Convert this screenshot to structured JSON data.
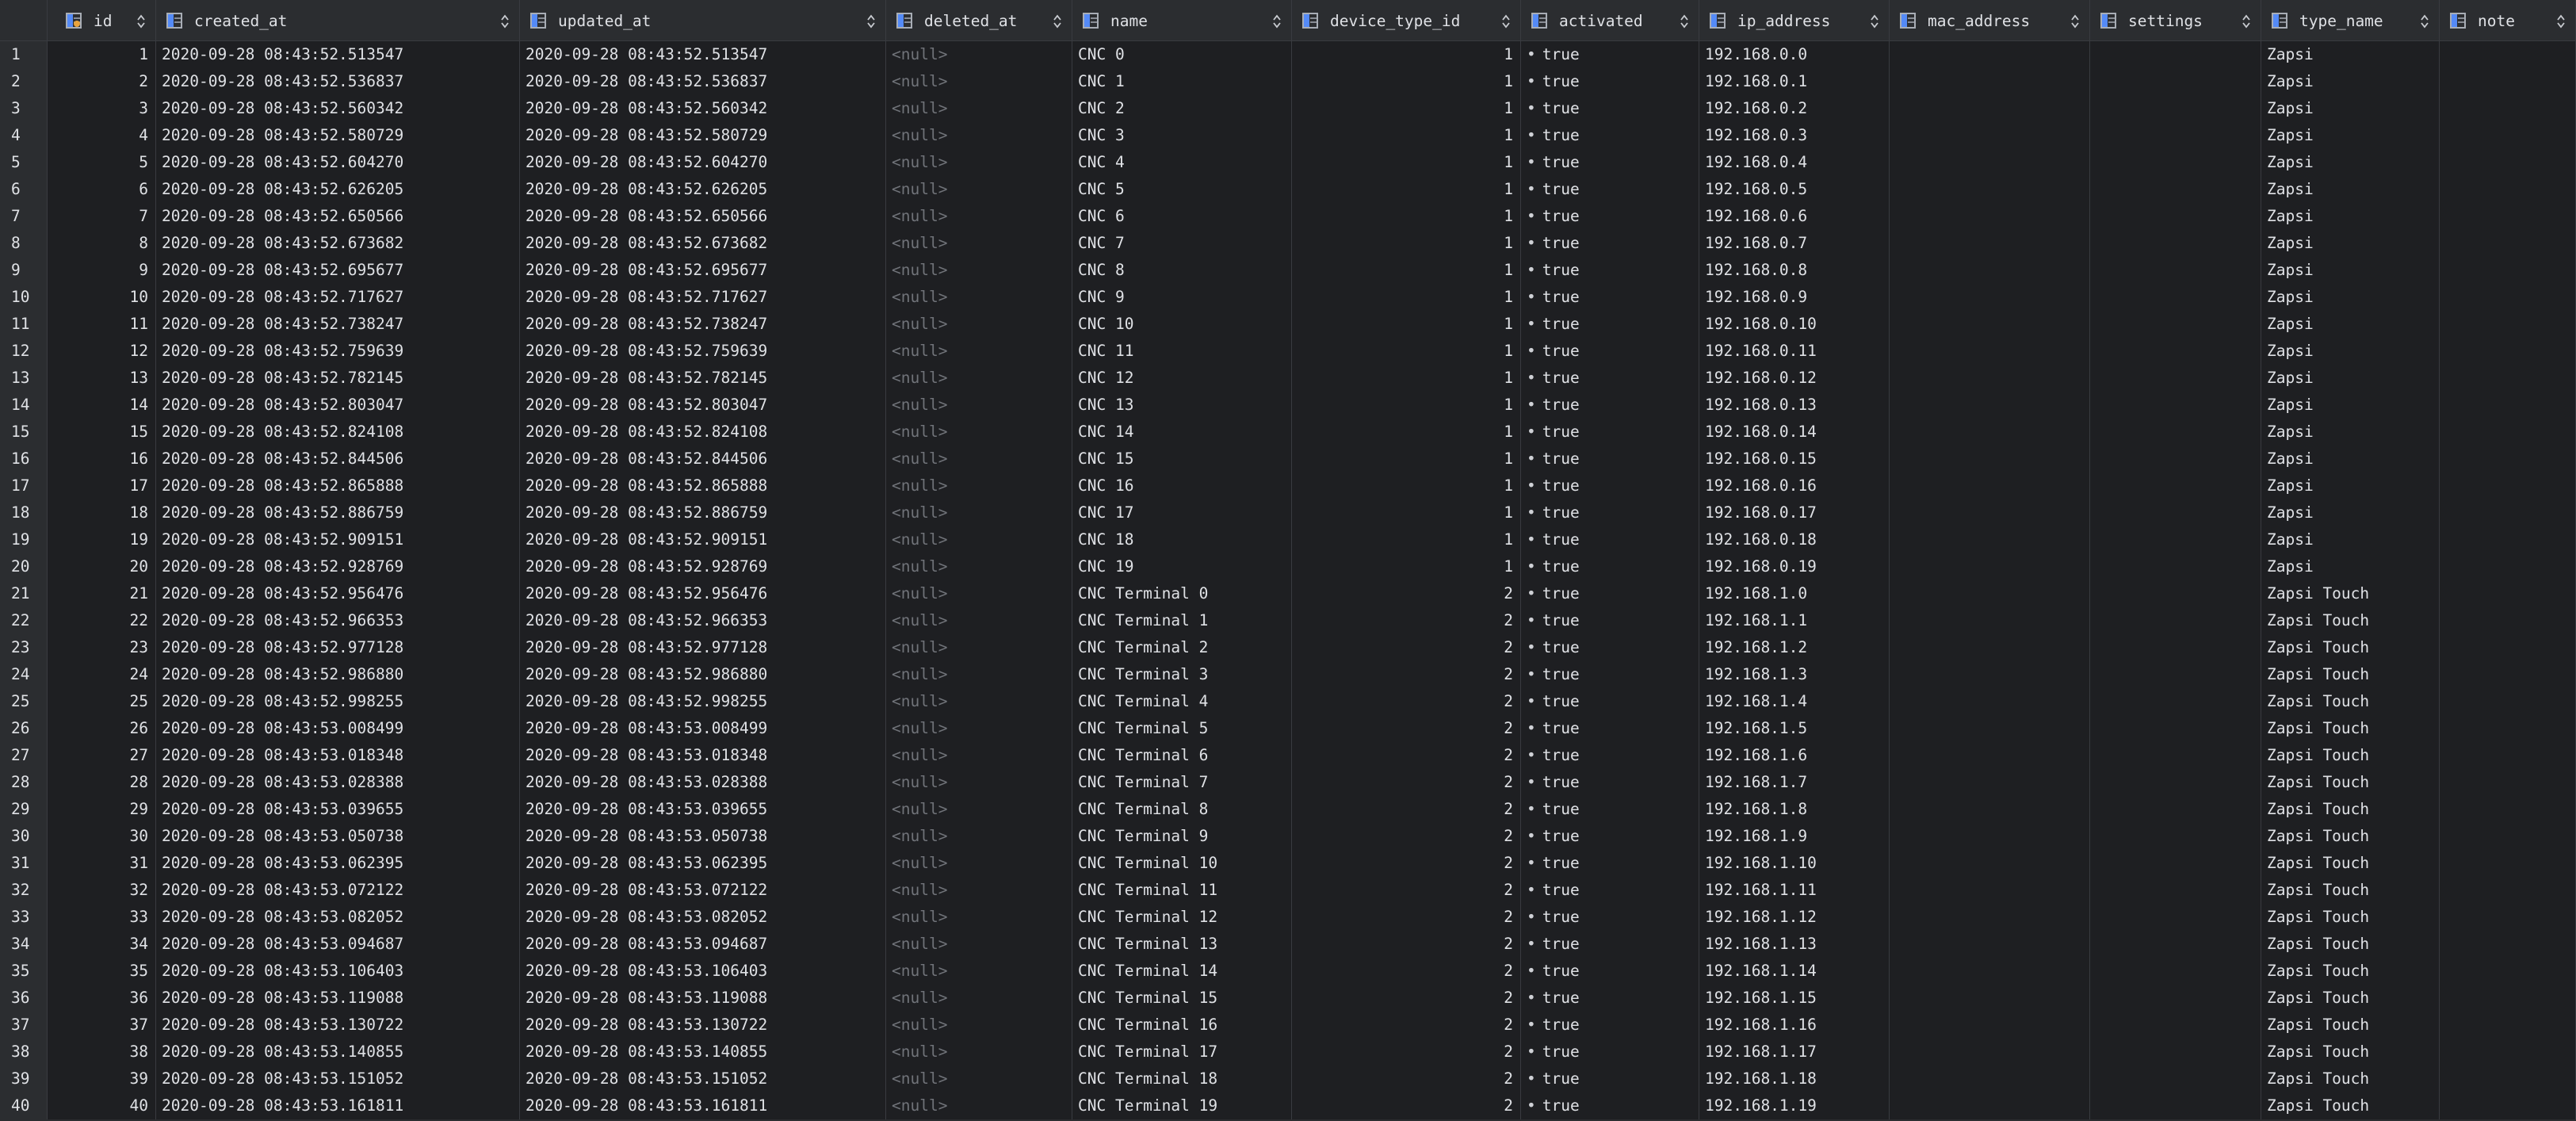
{
  "columns": [
    {
      "key": "id",
      "label": "id",
      "icon": "primary-key-column-icon"
    },
    {
      "key": "created_at",
      "label": "created_at",
      "icon": "column-icon"
    },
    {
      "key": "updated_at",
      "label": "updated_at",
      "icon": "column-icon"
    },
    {
      "key": "deleted_at",
      "label": "deleted_at",
      "icon": "column-icon"
    },
    {
      "key": "name",
      "label": "name",
      "icon": "column-icon"
    },
    {
      "key": "device_type_id",
      "label": "device_type_id",
      "icon": "column-icon"
    },
    {
      "key": "activated",
      "label": "activated",
      "icon": "column-icon"
    },
    {
      "key": "ip_address",
      "label": "ip_address",
      "icon": "column-icon"
    },
    {
      "key": "mac_address",
      "label": "mac_address",
      "icon": "column-icon"
    },
    {
      "key": "settings",
      "label": "settings",
      "icon": "column-icon"
    },
    {
      "key": "type_name",
      "label": "type_name",
      "icon": "column-icon"
    },
    {
      "key": "note",
      "label": "note",
      "icon": "column-icon"
    }
  ],
  "null_text": "<null>",
  "bool_marker": "•",
  "rows": [
    {
      "row": "1",
      "id": "1",
      "created_at": "2020-09-28 08:43:52.513547",
      "updated_at": "2020-09-28 08:43:52.513547",
      "deleted_at": "<null>",
      "name": "CNC 0",
      "device_type_id": "1",
      "activated": "true",
      "ip_address": "192.168.0.0",
      "mac_address": "",
      "settings": "",
      "type_name": "Zapsi",
      "note": ""
    },
    {
      "row": "2",
      "id": "2",
      "created_at": "2020-09-28 08:43:52.536837",
      "updated_at": "2020-09-28 08:43:52.536837",
      "deleted_at": "<null>",
      "name": "CNC 1",
      "device_type_id": "1",
      "activated": "true",
      "ip_address": "192.168.0.1",
      "mac_address": "",
      "settings": "",
      "type_name": "Zapsi",
      "note": ""
    },
    {
      "row": "3",
      "id": "3",
      "created_at": "2020-09-28 08:43:52.560342",
      "updated_at": "2020-09-28 08:43:52.560342",
      "deleted_at": "<null>",
      "name": "CNC 2",
      "device_type_id": "1",
      "activated": "true",
      "ip_address": "192.168.0.2",
      "mac_address": "",
      "settings": "",
      "type_name": "Zapsi",
      "note": ""
    },
    {
      "row": "4",
      "id": "4",
      "created_at": "2020-09-28 08:43:52.580729",
      "updated_at": "2020-09-28 08:43:52.580729",
      "deleted_at": "<null>",
      "name": "CNC 3",
      "device_type_id": "1",
      "activated": "true",
      "ip_address": "192.168.0.3",
      "mac_address": "",
      "settings": "",
      "type_name": "Zapsi",
      "note": ""
    },
    {
      "row": "5",
      "id": "5",
      "created_at": "2020-09-28 08:43:52.604270",
      "updated_at": "2020-09-28 08:43:52.604270",
      "deleted_at": "<null>",
      "name": "CNC 4",
      "device_type_id": "1",
      "activated": "true",
      "ip_address": "192.168.0.4",
      "mac_address": "",
      "settings": "",
      "type_name": "Zapsi",
      "note": ""
    },
    {
      "row": "6",
      "id": "6",
      "created_at": "2020-09-28 08:43:52.626205",
      "updated_at": "2020-09-28 08:43:52.626205",
      "deleted_at": "<null>",
      "name": "CNC 5",
      "device_type_id": "1",
      "activated": "true",
      "ip_address": "192.168.0.5",
      "mac_address": "",
      "settings": "",
      "type_name": "Zapsi",
      "note": ""
    },
    {
      "row": "7",
      "id": "7",
      "created_at": "2020-09-28 08:43:52.650566",
      "updated_at": "2020-09-28 08:43:52.650566",
      "deleted_at": "<null>",
      "name": "CNC 6",
      "device_type_id": "1",
      "activated": "true",
      "ip_address": "192.168.0.6",
      "mac_address": "",
      "settings": "",
      "type_name": "Zapsi",
      "note": ""
    },
    {
      "row": "8",
      "id": "8",
      "created_at": "2020-09-28 08:43:52.673682",
      "updated_at": "2020-09-28 08:43:52.673682",
      "deleted_at": "<null>",
      "name": "CNC 7",
      "device_type_id": "1",
      "activated": "true",
      "ip_address": "192.168.0.7",
      "mac_address": "",
      "settings": "",
      "type_name": "Zapsi",
      "note": ""
    },
    {
      "row": "9",
      "id": "9",
      "created_at": "2020-09-28 08:43:52.695677",
      "updated_at": "2020-09-28 08:43:52.695677",
      "deleted_at": "<null>",
      "name": "CNC 8",
      "device_type_id": "1",
      "activated": "true",
      "ip_address": "192.168.0.8",
      "mac_address": "",
      "settings": "",
      "type_name": "Zapsi",
      "note": ""
    },
    {
      "row": "10",
      "id": "10",
      "created_at": "2020-09-28 08:43:52.717627",
      "updated_at": "2020-09-28 08:43:52.717627",
      "deleted_at": "<null>",
      "name": "CNC 9",
      "device_type_id": "1",
      "activated": "true",
      "ip_address": "192.168.0.9",
      "mac_address": "",
      "settings": "",
      "type_name": "Zapsi",
      "note": ""
    },
    {
      "row": "11",
      "id": "11",
      "created_at": "2020-09-28 08:43:52.738247",
      "updated_at": "2020-09-28 08:43:52.738247",
      "deleted_at": "<null>",
      "name": "CNC 10",
      "device_type_id": "1",
      "activated": "true",
      "ip_address": "192.168.0.10",
      "mac_address": "",
      "settings": "",
      "type_name": "Zapsi",
      "note": ""
    },
    {
      "row": "12",
      "id": "12",
      "created_at": "2020-09-28 08:43:52.759639",
      "updated_at": "2020-09-28 08:43:52.759639",
      "deleted_at": "<null>",
      "name": "CNC 11",
      "device_type_id": "1",
      "activated": "true",
      "ip_address": "192.168.0.11",
      "mac_address": "",
      "settings": "",
      "type_name": "Zapsi",
      "note": ""
    },
    {
      "row": "13",
      "id": "13",
      "created_at": "2020-09-28 08:43:52.782145",
      "updated_at": "2020-09-28 08:43:52.782145",
      "deleted_at": "<null>",
      "name": "CNC 12",
      "device_type_id": "1",
      "activated": "true",
      "ip_address": "192.168.0.12",
      "mac_address": "",
      "settings": "",
      "type_name": "Zapsi",
      "note": ""
    },
    {
      "row": "14",
      "id": "14",
      "created_at": "2020-09-28 08:43:52.803047",
      "updated_at": "2020-09-28 08:43:52.803047",
      "deleted_at": "<null>",
      "name": "CNC 13",
      "device_type_id": "1",
      "activated": "true",
      "ip_address": "192.168.0.13",
      "mac_address": "",
      "settings": "",
      "type_name": "Zapsi",
      "note": ""
    },
    {
      "row": "15",
      "id": "15",
      "created_at": "2020-09-28 08:43:52.824108",
      "updated_at": "2020-09-28 08:43:52.824108",
      "deleted_at": "<null>",
      "name": "CNC 14",
      "device_type_id": "1",
      "activated": "true",
      "ip_address": "192.168.0.14",
      "mac_address": "",
      "settings": "",
      "type_name": "Zapsi",
      "note": ""
    },
    {
      "row": "16",
      "id": "16",
      "created_at": "2020-09-28 08:43:52.844506",
      "updated_at": "2020-09-28 08:43:52.844506",
      "deleted_at": "<null>",
      "name": "CNC 15",
      "device_type_id": "1",
      "activated": "true",
      "ip_address": "192.168.0.15",
      "mac_address": "",
      "settings": "",
      "type_name": "Zapsi",
      "note": ""
    },
    {
      "row": "17",
      "id": "17",
      "created_at": "2020-09-28 08:43:52.865888",
      "updated_at": "2020-09-28 08:43:52.865888",
      "deleted_at": "<null>",
      "name": "CNC 16",
      "device_type_id": "1",
      "activated": "true",
      "ip_address": "192.168.0.16",
      "mac_address": "",
      "settings": "",
      "type_name": "Zapsi",
      "note": ""
    },
    {
      "row": "18",
      "id": "18",
      "created_at": "2020-09-28 08:43:52.886759",
      "updated_at": "2020-09-28 08:43:52.886759",
      "deleted_at": "<null>",
      "name": "CNC 17",
      "device_type_id": "1",
      "activated": "true",
      "ip_address": "192.168.0.17",
      "mac_address": "",
      "settings": "",
      "type_name": "Zapsi",
      "note": ""
    },
    {
      "row": "19",
      "id": "19",
      "created_at": "2020-09-28 08:43:52.909151",
      "updated_at": "2020-09-28 08:43:52.909151",
      "deleted_at": "<null>",
      "name": "CNC 18",
      "device_type_id": "1",
      "activated": "true",
      "ip_address": "192.168.0.18",
      "mac_address": "",
      "settings": "",
      "type_name": "Zapsi",
      "note": ""
    },
    {
      "row": "20",
      "id": "20",
      "created_at": "2020-09-28 08:43:52.928769",
      "updated_at": "2020-09-28 08:43:52.928769",
      "deleted_at": "<null>",
      "name": "CNC 19",
      "device_type_id": "1",
      "activated": "true",
      "ip_address": "192.168.0.19",
      "mac_address": "",
      "settings": "",
      "type_name": "Zapsi",
      "note": ""
    },
    {
      "row": "21",
      "id": "21",
      "created_at": "2020-09-28 08:43:52.956476",
      "updated_at": "2020-09-28 08:43:52.956476",
      "deleted_at": "<null>",
      "name": "CNC Terminal 0",
      "device_type_id": "2",
      "activated": "true",
      "ip_address": "192.168.1.0",
      "mac_address": "",
      "settings": "",
      "type_name": "Zapsi Touch",
      "note": ""
    },
    {
      "row": "22",
      "id": "22",
      "created_at": "2020-09-28 08:43:52.966353",
      "updated_at": "2020-09-28 08:43:52.966353",
      "deleted_at": "<null>",
      "name": "CNC Terminal 1",
      "device_type_id": "2",
      "activated": "true",
      "ip_address": "192.168.1.1",
      "mac_address": "",
      "settings": "",
      "type_name": "Zapsi Touch",
      "note": ""
    },
    {
      "row": "23",
      "id": "23",
      "created_at": "2020-09-28 08:43:52.977128",
      "updated_at": "2020-09-28 08:43:52.977128",
      "deleted_at": "<null>",
      "name": "CNC Terminal 2",
      "device_type_id": "2",
      "activated": "true",
      "ip_address": "192.168.1.2",
      "mac_address": "",
      "settings": "",
      "type_name": "Zapsi Touch",
      "note": ""
    },
    {
      "row": "24",
      "id": "24",
      "created_at": "2020-09-28 08:43:52.986880",
      "updated_at": "2020-09-28 08:43:52.986880",
      "deleted_at": "<null>",
      "name": "CNC Terminal 3",
      "device_type_id": "2",
      "activated": "true",
      "ip_address": "192.168.1.3",
      "mac_address": "",
      "settings": "",
      "type_name": "Zapsi Touch",
      "note": ""
    },
    {
      "row": "25",
      "id": "25",
      "created_at": "2020-09-28 08:43:52.998255",
      "updated_at": "2020-09-28 08:43:52.998255",
      "deleted_at": "<null>",
      "name": "CNC Terminal 4",
      "device_type_id": "2",
      "activated": "true",
      "ip_address": "192.168.1.4",
      "mac_address": "",
      "settings": "",
      "type_name": "Zapsi Touch",
      "note": ""
    },
    {
      "row": "26",
      "id": "26",
      "created_at": "2020-09-28 08:43:53.008499",
      "updated_at": "2020-09-28 08:43:53.008499",
      "deleted_at": "<null>",
      "name": "CNC Terminal 5",
      "device_type_id": "2",
      "activated": "true",
      "ip_address": "192.168.1.5",
      "mac_address": "",
      "settings": "",
      "type_name": "Zapsi Touch",
      "note": ""
    },
    {
      "row": "27",
      "id": "27",
      "created_at": "2020-09-28 08:43:53.018348",
      "updated_at": "2020-09-28 08:43:53.018348",
      "deleted_at": "<null>",
      "name": "CNC Terminal 6",
      "device_type_id": "2",
      "activated": "true",
      "ip_address": "192.168.1.6",
      "mac_address": "",
      "settings": "",
      "type_name": "Zapsi Touch",
      "note": ""
    },
    {
      "row": "28",
      "id": "28",
      "created_at": "2020-09-28 08:43:53.028388",
      "updated_at": "2020-09-28 08:43:53.028388",
      "deleted_at": "<null>",
      "name": "CNC Terminal 7",
      "device_type_id": "2",
      "activated": "true",
      "ip_address": "192.168.1.7",
      "mac_address": "",
      "settings": "",
      "type_name": "Zapsi Touch",
      "note": ""
    },
    {
      "row": "29",
      "id": "29",
      "created_at": "2020-09-28 08:43:53.039655",
      "updated_at": "2020-09-28 08:43:53.039655",
      "deleted_at": "<null>",
      "name": "CNC Terminal 8",
      "device_type_id": "2",
      "activated": "true",
      "ip_address": "192.168.1.8",
      "mac_address": "",
      "settings": "",
      "type_name": "Zapsi Touch",
      "note": ""
    },
    {
      "row": "30",
      "id": "30",
      "created_at": "2020-09-28 08:43:53.050738",
      "updated_at": "2020-09-28 08:43:53.050738",
      "deleted_at": "<null>",
      "name": "CNC Terminal 9",
      "device_type_id": "2",
      "activated": "true",
      "ip_address": "192.168.1.9",
      "mac_address": "",
      "settings": "",
      "type_name": "Zapsi Touch",
      "note": ""
    },
    {
      "row": "31",
      "id": "31",
      "created_at": "2020-09-28 08:43:53.062395",
      "updated_at": "2020-09-28 08:43:53.062395",
      "deleted_at": "<null>",
      "name": "CNC Terminal 10",
      "device_type_id": "2",
      "activated": "true",
      "ip_address": "192.168.1.10",
      "mac_address": "",
      "settings": "",
      "type_name": "Zapsi Touch",
      "note": ""
    },
    {
      "row": "32",
      "id": "32",
      "created_at": "2020-09-28 08:43:53.072122",
      "updated_at": "2020-09-28 08:43:53.072122",
      "deleted_at": "<null>",
      "name": "CNC Terminal 11",
      "device_type_id": "2",
      "activated": "true",
      "ip_address": "192.168.1.11",
      "mac_address": "",
      "settings": "",
      "type_name": "Zapsi Touch",
      "note": ""
    },
    {
      "row": "33",
      "id": "33",
      "created_at": "2020-09-28 08:43:53.082052",
      "updated_at": "2020-09-28 08:43:53.082052",
      "deleted_at": "<null>",
      "name": "CNC Terminal 12",
      "device_type_id": "2",
      "activated": "true",
      "ip_address": "192.168.1.12",
      "mac_address": "",
      "settings": "",
      "type_name": "Zapsi Touch",
      "note": ""
    },
    {
      "row": "34",
      "id": "34",
      "created_at": "2020-09-28 08:43:53.094687",
      "updated_at": "2020-09-28 08:43:53.094687",
      "deleted_at": "<null>",
      "name": "CNC Terminal 13",
      "device_type_id": "2",
      "activated": "true",
      "ip_address": "192.168.1.13",
      "mac_address": "",
      "settings": "",
      "type_name": "Zapsi Touch",
      "note": ""
    },
    {
      "row": "35",
      "id": "35",
      "created_at": "2020-09-28 08:43:53.106403",
      "updated_at": "2020-09-28 08:43:53.106403",
      "deleted_at": "<null>",
      "name": "CNC Terminal 14",
      "device_type_id": "2",
      "activated": "true",
      "ip_address": "192.168.1.14",
      "mac_address": "",
      "settings": "",
      "type_name": "Zapsi Touch",
      "note": ""
    },
    {
      "row": "36",
      "id": "36",
      "created_at": "2020-09-28 08:43:53.119088",
      "updated_at": "2020-09-28 08:43:53.119088",
      "deleted_at": "<null>",
      "name": "CNC Terminal 15",
      "device_type_id": "2",
      "activated": "true",
      "ip_address": "192.168.1.15",
      "mac_address": "",
      "settings": "",
      "type_name": "Zapsi Touch",
      "note": ""
    },
    {
      "row": "37",
      "id": "37",
      "created_at": "2020-09-28 08:43:53.130722",
      "updated_at": "2020-09-28 08:43:53.130722",
      "deleted_at": "<null>",
      "name": "CNC Terminal 16",
      "device_type_id": "2",
      "activated": "true",
      "ip_address": "192.168.1.16",
      "mac_address": "",
      "settings": "",
      "type_name": "Zapsi Touch",
      "note": ""
    },
    {
      "row": "38",
      "id": "38",
      "created_at": "2020-09-28 08:43:53.140855",
      "updated_at": "2020-09-28 08:43:53.140855",
      "deleted_at": "<null>",
      "name": "CNC Terminal 17",
      "device_type_id": "2",
      "activated": "true",
      "ip_address": "192.168.1.17",
      "mac_address": "",
      "settings": "",
      "type_name": "Zapsi Touch",
      "note": ""
    },
    {
      "row": "39",
      "id": "39",
      "created_at": "2020-09-28 08:43:53.151052",
      "updated_at": "2020-09-28 08:43:53.151052",
      "deleted_at": "<null>",
      "name": "CNC Terminal 18",
      "device_type_id": "2",
      "activated": "true",
      "ip_address": "192.168.1.18",
      "mac_address": "",
      "settings": "",
      "type_name": "Zapsi Touch",
      "note": ""
    },
    {
      "row": "40",
      "id": "40",
      "created_at": "2020-09-28 08:43:53.161811",
      "updated_at": "2020-09-28 08:43:53.161811",
      "deleted_at": "<null>",
      "name": "CNC Terminal 19",
      "device_type_id": "2",
      "activated": "true",
      "ip_address": "192.168.1.19",
      "mac_address": "",
      "settings": "",
      "type_name": "Zapsi Touch",
      "note": ""
    }
  ],
  "colors": {
    "cell_background": "#1e1f22",
    "header_background": "#2b2d30",
    "grid_line": "#393b40",
    "text": "#dfe1e5",
    "null_text": "#707379",
    "icon_blue": "#548af7",
    "key_icon": "#e8a33d"
  }
}
